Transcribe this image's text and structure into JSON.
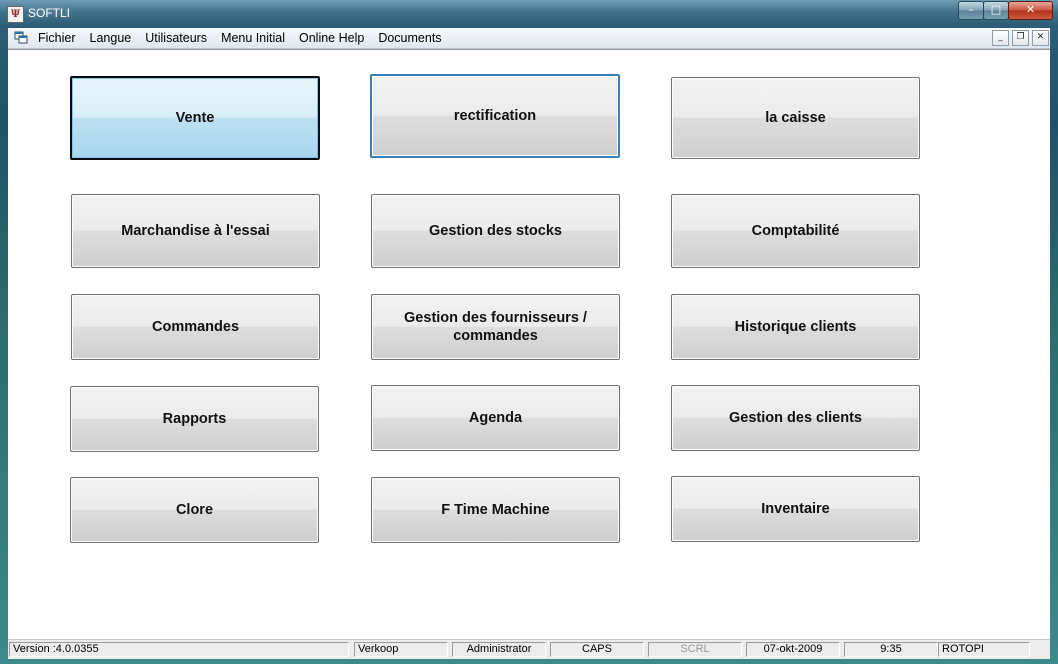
{
  "window": {
    "title": "SOFTLI",
    "icon": "app-logo-icon",
    "controls": {
      "minimize": "–",
      "maximize": "□",
      "close": "✕"
    }
  },
  "menubar": {
    "system_icon": "mdi-system-menu-icon",
    "items": [
      "Fichier",
      "Langue",
      "Utilisateurs",
      "Menu Initial",
      "Online Help",
      "Documents"
    ],
    "mdi_controls": {
      "minimize": "_",
      "restore": "❐",
      "close": "✕"
    }
  },
  "buttons": [
    {
      "label": "Vente",
      "state": "active"
    },
    {
      "label": "rectification",
      "state": "focus"
    },
    {
      "label": "la caisse",
      "state": "normal"
    },
    {
      "label": "Marchandise à l'essai",
      "state": "normal"
    },
    {
      "label": "Gestion des stocks",
      "state": "normal"
    },
    {
      "label": "Comptabilité",
      "state": "normal"
    },
    {
      "label": "Commandes",
      "state": "normal"
    },
    {
      "label": "Gestion des fournisseurs / commandes",
      "state": "normal"
    },
    {
      "label": "Historique clients",
      "state": "normal"
    },
    {
      "label": "Rapports",
      "state": "normal"
    },
    {
      "label": "Agenda",
      "state": "normal"
    },
    {
      "label": "Gestion des clients",
      "state": "normal"
    },
    {
      "label": "Clore",
      "state": "normal"
    },
    {
      "label": "F Time Machine",
      "state": "normal"
    },
    {
      "label": "Inventaire",
      "state": "normal"
    }
  ],
  "statusbar": {
    "version": "Version :4.0.0355",
    "mode": "Verkoop",
    "user": "Administrator",
    "caps": "CAPS",
    "scrl": "SCRL",
    "date": "07-okt-2009",
    "time": "9:35",
    "station": "ROTOPI"
  },
  "colors": {
    "active_button": "#bde0f2",
    "focus_border": "#3c7fb1",
    "button_face": "#e3e3e3",
    "close_button": "#c9523e"
  }
}
